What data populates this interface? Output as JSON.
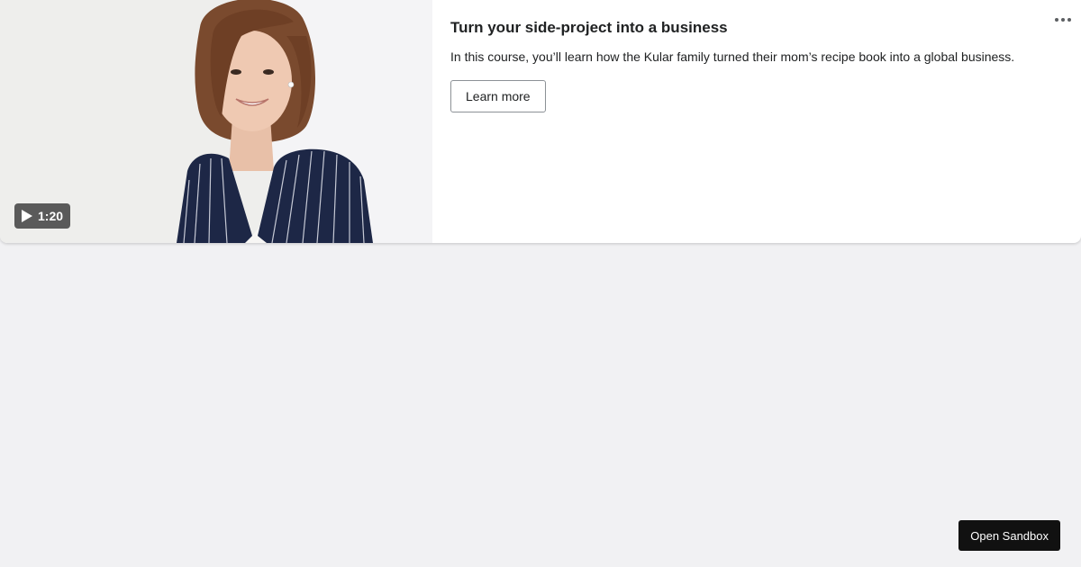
{
  "card": {
    "title": "Turn your side-project into a business",
    "description": "In this course, you’ll learn how the Kular family turned their mom’s recipe book into a global business.",
    "cta_label": "Learn more",
    "more_icon": "horizontal-dots-icon"
  },
  "video": {
    "duration": "1:20",
    "play_icon": "play-icon"
  },
  "sandbox": {
    "label": "Open Sandbox"
  },
  "colors": {
    "page_background": "#f1f1f3",
    "card_background": "#ffffff",
    "text": "#202223",
    "sandbox_button": "#111111",
    "badge_background": "#464646"
  }
}
